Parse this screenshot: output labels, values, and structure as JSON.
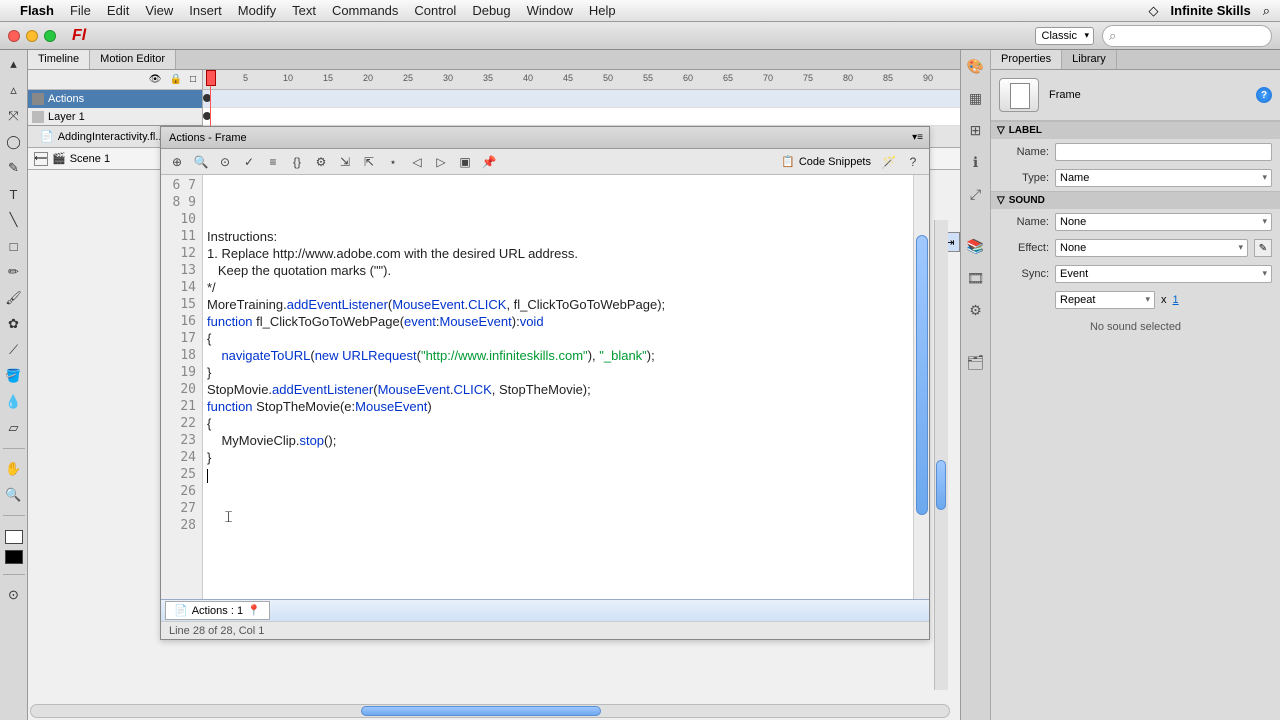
{
  "menubar": {
    "app": "Flash",
    "items": [
      "File",
      "Edit",
      "View",
      "Insert",
      "Modify",
      "Text",
      "Commands",
      "Control",
      "Debug",
      "Window",
      "Help"
    ],
    "right_label": "Infinite Skills"
  },
  "workspace": {
    "selected": "Classic"
  },
  "timeline_tabs": {
    "timeline": "Timeline",
    "motion": "Motion Editor"
  },
  "layers": [
    {
      "name": "Actions",
      "selected": true
    },
    {
      "name": "Layer 1",
      "selected": false
    }
  ],
  "ruler_marks": [
    5,
    10,
    15,
    20,
    25,
    30,
    35,
    40,
    45,
    50,
    55,
    60,
    65,
    70,
    75,
    80,
    85,
    90
  ],
  "filetab": "AddingInteractivity.fl...",
  "scene": {
    "name": "Scene 1"
  },
  "actions": {
    "title": "Actions - Frame",
    "snippets_label": "Code Snippets",
    "bottom_tab": "Actions : 1",
    "status": "Line 28 of 28, Col 1",
    "gutter_start": 6,
    "gutter_end": 28,
    "code_lines": [
      {
        "t": "Instructions:"
      },
      {
        "t": "1. Replace http://www.adobe.com with the desired URL address."
      },
      {
        "t": "   Keep the quotation marks (\"\")."
      },
      {
        "t": "*/"
      },
      {
        "t": ""
      },
      {
        "html": "MoreTraining.<span class='method'>addEventListener</span>(<span class='type'>MouseEvent</span>.<span class='type'>CLICK</span>, fl_ClickToGoToWebPage);"
      },
      {
        "t": ""
      },
      {
        "html": "<span class='kw'>function</span> fl_ClickToGoToWebPage(<span class='type'>event</span>:<span class='type'>MouseEvent</span>):<span class='kw'>void</span>"
      },
      {
        "t": "{"
      },
      {
        "html": "    <span class='method'>navigateToURL</span>(<span class='kw'>new</span> <span class='type'>URLRequest</span>(<span class='str'>\"http://www.infiniteskills.com\"</span>), <span class='str'>\"_blank\"</span>);"
      },
      {
        "t": "}"
      },
      {
        "t": ""
      },
      {
        "html": "StopMovie.<span class='method'>addEventListener</span>(<span class='type'>MouseEvent</span>.<span class='type'>CLICK</span>, StopTheMovie);"
      },
      {
        "t": ""
      },
      {
        "html": "<span class='kw'>function</span> StopTheMovie(e:<span class='type'>MouseEvent</span>)"
      },
      {
        "t": "{"
      },
      {
        "html": "    MyMovieClip.<span class='method'>stop</span>();"
      },
      {
        "t": "}"
      },
      {
        "t": ""
      },
      {
        "t": ""
      },
      {
        "t": ""
      },
      {
        "t": ""
      },
      {
        "t": ""
      }
    ]
  },
  "properties": {
    "tabs": {
      "props": "Properties",
      "lib": "Library"
    },
    "title": "Frame",
    "label_section": "LABEL",
    "name_label": "Name:",
    "name_value": "",
    "type_label": "Type:",
    "type_value": "Name",
    "sound_section": "SOUND",
    "snd_name_label": "Name:",
    "snd_name_value": "None",
    "effect_label": "Effect:",
    "effect_value": "None",
    "sync_label": "Sync:",
    "sync_value": "Event",
    "repeat_value": "Repeat",
    "repeat_x": "x",
    "repeat_count": "1",
    "no_sound": "No sound selected"
  }
}
